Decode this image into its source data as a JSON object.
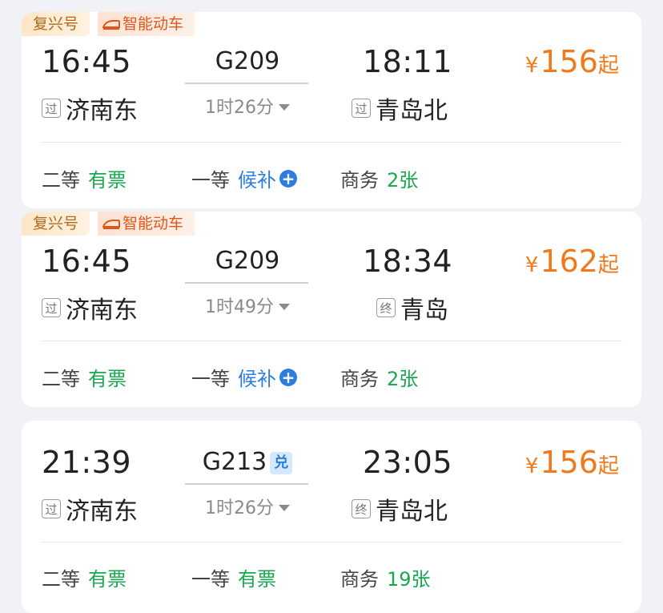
{
  "colors": {
    "price": "#f07a1a",
    "available": "#1aa84f",
    "waitlist": "#2b7de0",
    "tag_fuxing": "#b06a1c",
    "tag_smart": "#e0571b"
  },
  "trains": [
    {
      "tags": [
        "复兴号",
        "智能动车"
      ],
      "dep_time": "16:45",
      "train_no": "G209",
      "arr_time": "18:11",
      "dep_badge": "过",
      "dep_station": "济南东",
      "duration": "1时26分",
      "arr_badge": "过",
      "arr_station": "青岛北",
      "price_symbol": "¥",
      "price": "156",
      "price_suffix": "起",
      "seats": [
        {
          "class": "二等",
          "status": "有票"
        },
        {
          "class": "一等",
          "status": "候补"
        },
        {
          "class": "商务",
          "status": "2张"
        }
      ]
    },
    {
      "tags": [
        "复兴号",
        "智能动车"
      ],
      "dep_time": "16:45",
      "train_no": "G209",
      "arr_time": "18:34",
      "dep_badge": "过",
      "dep_station": "济南东",
      "duration": "1时49分",
      "arr_badge": "终",
      "arr_station": "青岛",
      "price_symbol": "¥",
      "price": "162",
      "price_suffix": "起",
      "seats": [
        {
          "class": "二等",
          "status": "有票"
        },
        {
          "class": "一等",
          "status": "候补"
        },
        {
          "class": "商务",
          "status": "2张"
        }
      ]
    },
    {
      "tags": [],
      "dep_time": "21:39",
      "train_no": "G213",
      "train_badge": "兑",
      "arr_time": "23:05",
      "dep_badge": "过",
      "dep_station": "济南东",
      "duration": "1时26分",
      "arr_badge": "终",
      "arr_station": "青岛北",
      "price_symbol": "¥",
      "price": "156",
      "price_suffix": "起",
      "seats": [
        {
          "class": "二等",
          "status": "有票"
        },
        {
          "class": "一等",
          "status": "有票"
        },
        {
          "class": "商务",
          "status": "19张"
        }
      ]
    }
  ]
}
